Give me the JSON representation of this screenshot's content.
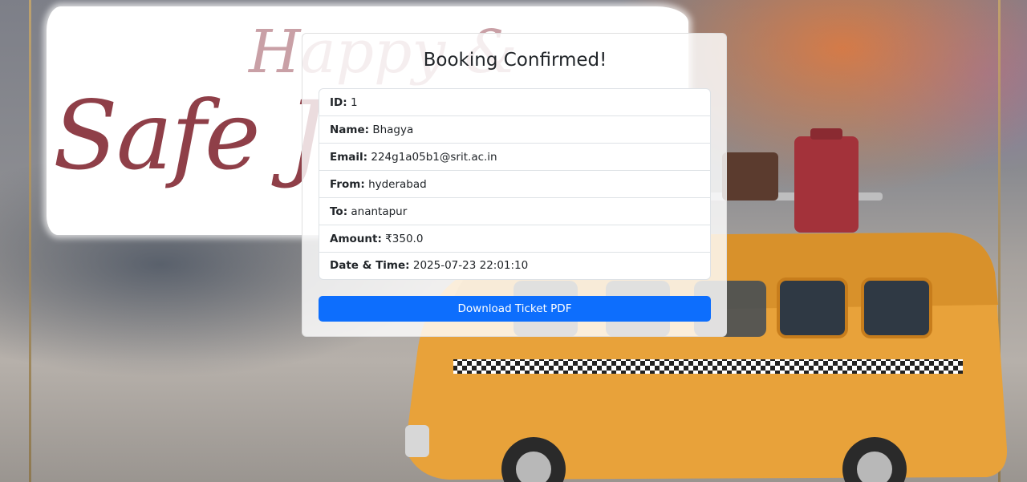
{
  "background": {
    "banner_text_main": "Safe J",
    "banner_text_top": "Happy &"
  },
  "card": {
    "title": "Booking Confirmed!",
    "details": [
      {
        "label": "ID:",
        "value": "1"
      },
      {
        "label": "Name:",
        "value": "Bhagya"
      },
      {
        "label": "Email:",
        "value": "224g1a05b1@srit.ac.in"
      },
      {
        "label": "From:",
        "value": "hyderabad"
      },
      {
        "label": "To:",
        "value": "anantapur"
      },
      {
        "label": "Amount:",
        "value": "₹350.0"
      },
      {
        "label": "Date & Time:",
        "value": "2025-07-23 22:01:10"
      }
    ],
    "download_label": "Download Ticket PDF"
  },
  "colors": {
    "primary_button": "#0d6efd",
    "banner_text": "#8f3f48"
  }
}
